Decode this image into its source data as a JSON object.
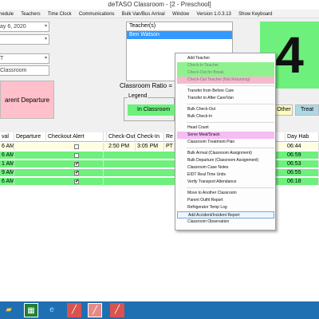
{
  "window": {
    "title": "deTASO Classroom - [2 - Preschool]"
  },
  "menu": [
    "Schedule",
    "Teachers",
    "Time Clock",
    "Communications",
    "Bulk Van/Bus Arrival",
    "Window",
    "Version 1.0.3.13",
    "Show Keyboard"
  ],
  "fields": {
    "date": "ay     6, 2020",
    "classroom": "Classroom",
    "field_t": "T"
  },
  "teachers": {
    "header": "Teacher(s)",
    "selected": "Ben Watson"
  },
  "count": "4",
  "parent_departure": "arent Departure",
  "ratio": "Classroom Ratio = 1",
  "legend": {
    "title": "Legend",
    "in_classroom": "In Classroom",
    "other": "Other",
    "treat": "Treat"
  },
  "grid": {
    "headers": [
      "val",
      "Departure",
      "Checkout Alert",
      "",
      "Check-Out",
      "Check-In",
      "Re",
      "",
      "Day Hab"
    ],
    "rows": [
      {
        "arr": "6 AM",
        "checkout": "2:50 PM",
        "checkin": "3:05 PM",
        "re": "PT",
        "hab": "06:44",
        "checked": false
      },
      {
        "arr": "6 AM",
        "checkout": "",
        "checkin": "",
        "re": "",
        "hab": "06:59",
        "checked": false
      },
      {
        "arr": "1 AM",
        "checkout": "",
        "checkin": "",
        "re": "",
        "hab": "06:53",
        "checked": true
      },
      {
        "arr": "9 AM",
        "checkout": "",
        "checkin": "",
        "re": "",
        "hab": "06:55",
        "checked": true
      },
      {
        "arr": "6 AM",
        "checkout": "",
        "checkin": "",
        "re": "",
        "hab": "06:18",
        "checked": true
      }
    ]
  },
  "context_menu": [
    "Add Teacher",
    "Check-In Teacher",
    "Check-Out for Break",
    "Check-Out Teacher (Not Returning)",
    "Transfer from Before Care",
    "Transfer to After Care/Van",
    "Bulk Check-Out",
    "Bulk Check-In",
    "Head Count",
    "Serve Meal/Snack",
    "Classroom Treatment Plan",
    "Bulk Arrival (Classroom Assignment)",
    "Bulk Departure (Classroom Assignment)",
    "Classroom Case Notes",
    "EIDT Real Time Units",
    "Verify Transport Attendance",
    "Move to Another Classroom",
    "Parent Outfit Report",
    "Refrigerator Temp Log",
    "Add Accident/Incident Report",
    "Classroom Observation"
  ],
  "colors": {
    "green": "#6ef07c",
    "pink": "#ffc0cb",
    "highlight": "#f6bcf4",
    "selection": "#3399ff",
    "taskbar": "#1f6fb3"
  },
  "taskbar_icons": [
    "folder-icon",
    "excel-icon",
    "ie-icon",
    "app-icon",
    "app-active-icon",
    "app-icon-2"
  ]
}
